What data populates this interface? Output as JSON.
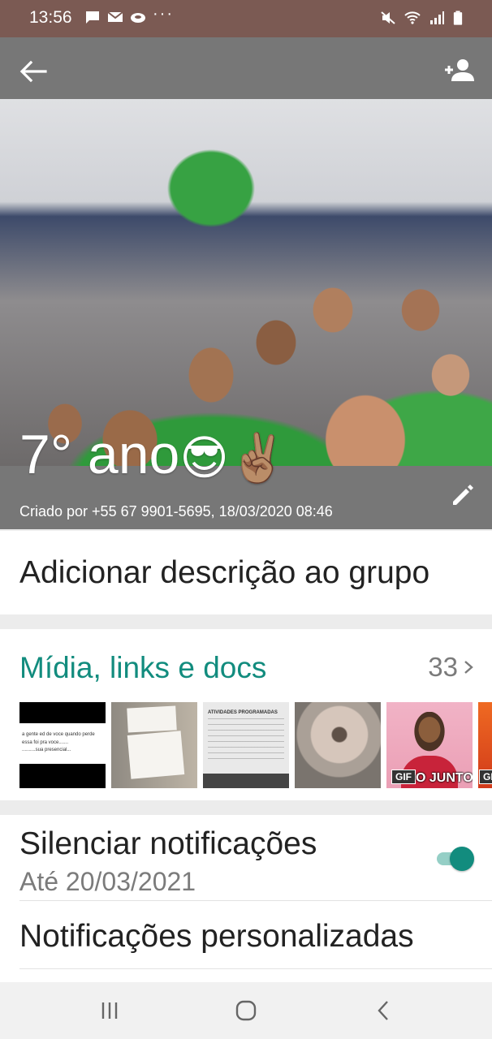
{
  "status_bar": {
    "time": "13:56",
    "left_icons": [
      "chat-icon",
      "email-icon",
      "cloud-icon",
      "more-dots"
    ],
    "right_icons": [
      "mute-icon",
      "wifi-icon",
      "signal-icon",
      "battery-icon"
    ],
    "dots": "···"
  },
  "header": {
    "group_name": "7° ano",
    "group_emojis": "😎✌🏽",
    "created_by": "Criado por +55 67 9901-5695, 18/03/2020 08:46",
    "back_icon": "arrow-back-icon",
    "add_participant_icon": "person-add-icon",
    "edit_icon": "pencil-icon"
  },
  "description": {
    "placeholder": "Adicionar descrição ao grupo"
  },
  "media": {
    "title": "Mídia, links e docs",
    "count": "33",
    "thumbnails": [
      {
        "type": "image",
        "text_lines": [
          "a gente ed de voce quando perde",
          "essa foi pra voce.......",
          "..........sua presencial..."
        ]
      },
      {
        "type": "image",
        "text_lines": []
      },
      {
        "type": "document",
        "text_lines": [
          "ATIVIDADES PROGRAMADAS"
        ]
      },
      {
        "type": "image",
        "text_lines": []
      },
      {
        "type": "gif",
        "badge": "GIF",
        "caption": "O JUNTO"
      },
      {
        "type": "gif",
        "badge": "GI"
      }
    ]
  },
  "notifications": {
    "mute_title": "Silenciar notificações",
    "mute_until": "Até 20/03/2021",
    "mute_enabled": true,
    "custom_title": "Notificações personalizadas"
  },
  "nav_bar": {
    "buttons": [
      "recent-apps",
      "home",
      "back"
    ]
  },
  "colors": {
    "accent": "#128c7e",
    "status_bar": "#7b5a53",
    "toggle_track": "#95cfc6"
  }
}
